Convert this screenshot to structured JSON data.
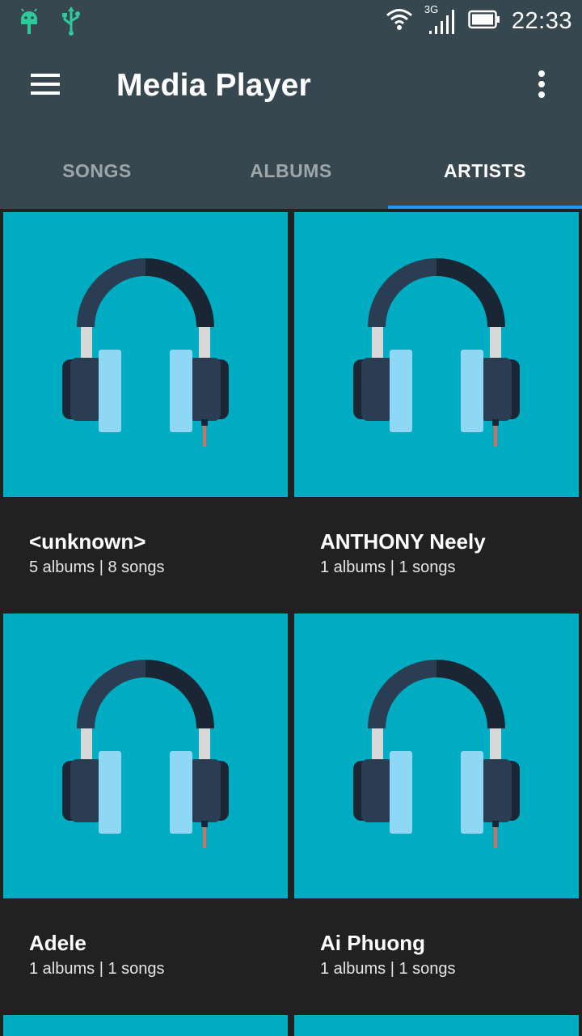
{
  "status_bar": {
    "time": "22:33",
    "network": "3G",
    "icons": [
      "android-icon",
      "usb-icon",
      "wifi-icon",
      "signal-icon",
      "battery-icon"
    ]
  },
  "app_bar": {
    "title": "Media Player",
    "icons": [
      "menu-icon",
      "more-vert-icon"
    ]
  },
  "tabs": [
    {
      "label": "SONGS",
      "active": false
    },
    {
      "label": "ALBUMS",
      "active": false
    },
    {
      "label": "ARTISTS",
      "active": true
    }
  ],
  "artists": [
    {
      "name": "<unknown>",
      "meta": "5 albums | 8 songs"
    },
    {
      "name": "ANTHONY Neely",
      "meta": "1 albums | 1 songs"
    },
    {
      "name": "Adele",
      "meta": "1 albums | 1 songs"
    },
    {
      "name": "Ai Phuong",
      "meta": "1 albums | 1 songs"
    }
  ],
  "colors": {
    "app_bar": "#37474f",
    "tab_indicator": "#2196f3",
    "art_background": "#00acc1",
    "background": "#212121"
  }
}
